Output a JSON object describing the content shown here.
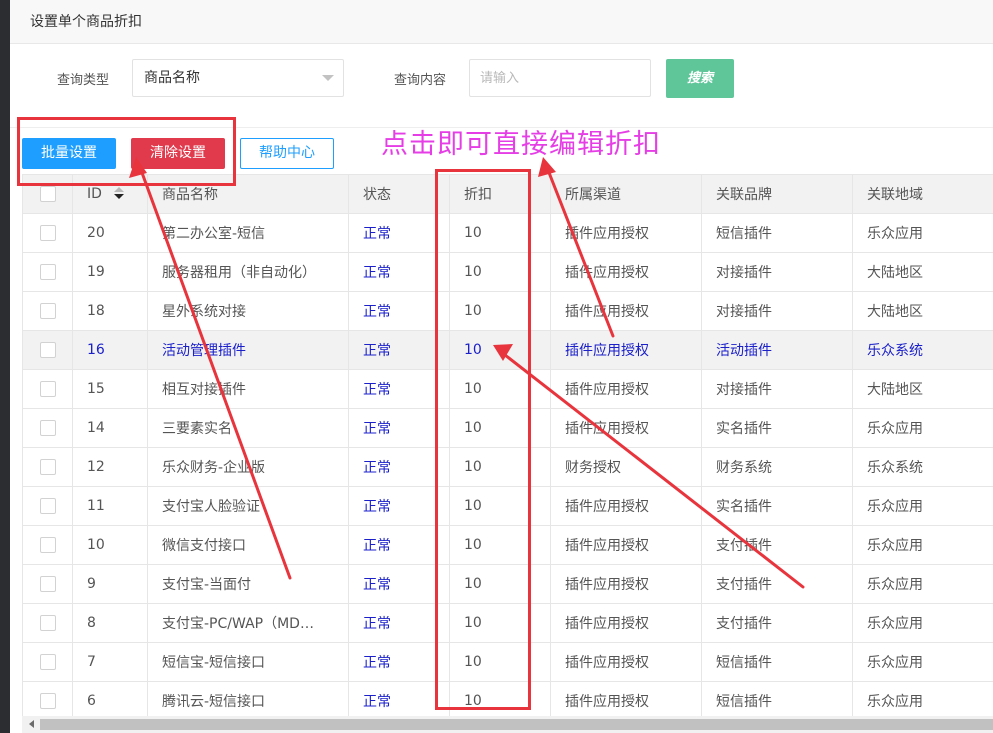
{
  "page": {
    "title": "设置单个商品折扣"
  },
  "search": {
    "type_label": "查询类型",
    "type_value": "商品名称",
    "content_label": "查询内容",
    "content_placeholder": "请输入",
    "search_button": "搜索"
  },
  "toolbar": {
    "batch_label": "批量设置",
    "clear_label": "清除设置",
    "help_label": "帮助中心"
  },
  "annotation": {
    "text": "点击即可直接编辑折扣"
  },
  "table": {
    "columns": [
      "ID",
      "商品名称",
      "状态",
      "折扣",
      "所属渠道",
      "关联品牌",
      "关联地域"
    ],
    "rows": [
      {
        "id": "20",
        "name": "第二办公室-短信",
        "status": "正常",
        "discount": "10",
        "channel": "插件应用授权",
        "brand": "短信插件",
        "region": "乐众应用"
      },
      {
        "id": "19",
        "name": "服务器租用（非自动化）",
        "status": "正常",
        "discount": "10",
        "channel": "插件应用授权",
        "brand": "对接插件",
        "region": "大陆地区"
      },
      {
        "id": "18",
        "name": "星外系统对接",
        "status": "正常",
        "discount": "10",
        "channel": "插件应用授权",
        "brand": "对接插件",
        "region": "大陆地区"
      },
      {
        "id": "16",
        "name": "活动管理插件",
        "status": "正常",
        "discount": "10",
        "channel": "插件应用授权",
        "brand": "活动插件",
        "region": "乐众系统"
      },
      {
        "id": "15",
        "name": "相互对接插件",
        "status": "正常",
        "discount": "10",
        "channel": "插件应用授权",
        "brand": "对接插件",
        "region": "大陆地区"
      },
      {
        "id": "14",
        "name": "三要素实名",
        "status": "正常",
        "discount": "10",
        "channel": "插件应用授权",
        "brand": "实名插件",
        "region": "乐众应用"
      },
      {
        "id": "12",
        "name": "乐众财务-企业版",
        "status": "正常",
        "discount": "10",
        "channel": "财务授权",
        "brand": "财务系统",
        "region": "乐众系统"
      },
      {
        "id": "11",
        "name": "支付宝人脸验证",
        "status": "正常",
        "discount": "10",
        "channel": "插件应用授权",
        "brand": "实名插件",
        "region": "乐众应用"
      },
      {
        "id": "10",
        "name": "微信支付接口",
        "status": "正常",
        "discount": "10",
        "channel": "插件应用授权",
        "brand": "支付插件",
        "region": "乐众应用"
      },
      {
        "id": "9",
        "name": "支付宝-当面付",
        "status": "正常",
        "discount": "10",
        "channel": "插件应用授权",
        "brand": "支付插件",
        "region": "乐众应用"
      },
      {
        "id": "8",
        "name": "支付宝-PC/WAP（MD…",
        "status": "正常",
        "discount": "10",
        "channel": "插件应用授权",
        "brand": "支付插件",
        "region": "乐众应用"
      },
      {
        "id": "7",
        "name": "短信宝-短信接口",
        "status": "正常",
        "discount": "10",
        "channel": "插件应用授权",
        "brand": "短信插件",
        "region": "乐众应用"
      },
      {
        "id": "6",
        "name": "腾讯云-短信接口",
        "status": "正常",
        "discount": "10",
        "channel": "插件应用授权",
        "brand": "短信插件",
        "region": "乐众应用"
      }
    ]
  },
  "colors": {
    "primary_blue": "#1e9fff",
    "danger_red": "#e03a4c",
    "search_green": "#5fc69a",
    "status_blue": "#1b20c9",
    "annotation_red": "#e8343c",
    "annotation_magenta": "#e63ee6"
  }
}
